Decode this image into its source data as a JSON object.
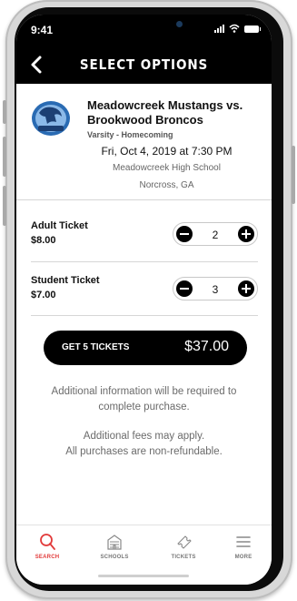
{
  "status_bar": {
    "time": "9:41"
  },
  "header": {
    "title": "SELECT OPTIONS"
  },
  "event": {
    "name": "Meadowcreek Mustangs vs. Brookwood Broncos",
    "level": "Varsity - Homecoming",
    "date": "Fri, Oct 4, 2019 at 7:30 PM",
    "school": "Meadowcreek High School",
    "city": "Norcross, GA"
  },
  "tickets": [
    {
      "name": "Adult Ticket",
      "price": "$8.00",
      "quantity": "2"
    },
    {
      "name": "Student Ticket",
      "price": "$7.00",
      "quantity": "3"
    }
  ],
  "cta": {
    "label": "GET 5 TICKETS",
    "total": "$37.00"
  },
  "info": {
    "line1": "Additional information will be required to complete purchase.",
    "line2": "Additional fees may apply.",
    "line3": "All purchases are non-refundable."
  },
  "tabbar": {
    "items": [
      {
        "label": "SEARCH",
        "icon": "search-icon",
        "active": true
      },
      {
        "label": "SCHOOLS",
        "icon": "school-icon",
        "active": false
      },
      {
        "label": "TICKETS",
        "icon": "ticket-icon",
        "active": false
      },
      {
        "label": "MORE",
        "icon": "menu-icon",
        "active": false
      }
    ]
  },
  "colors": {
    "header_bg": "#000000",
    "accent": "#e23b3b",
    "cta_bg": "#000000"
  }
}
